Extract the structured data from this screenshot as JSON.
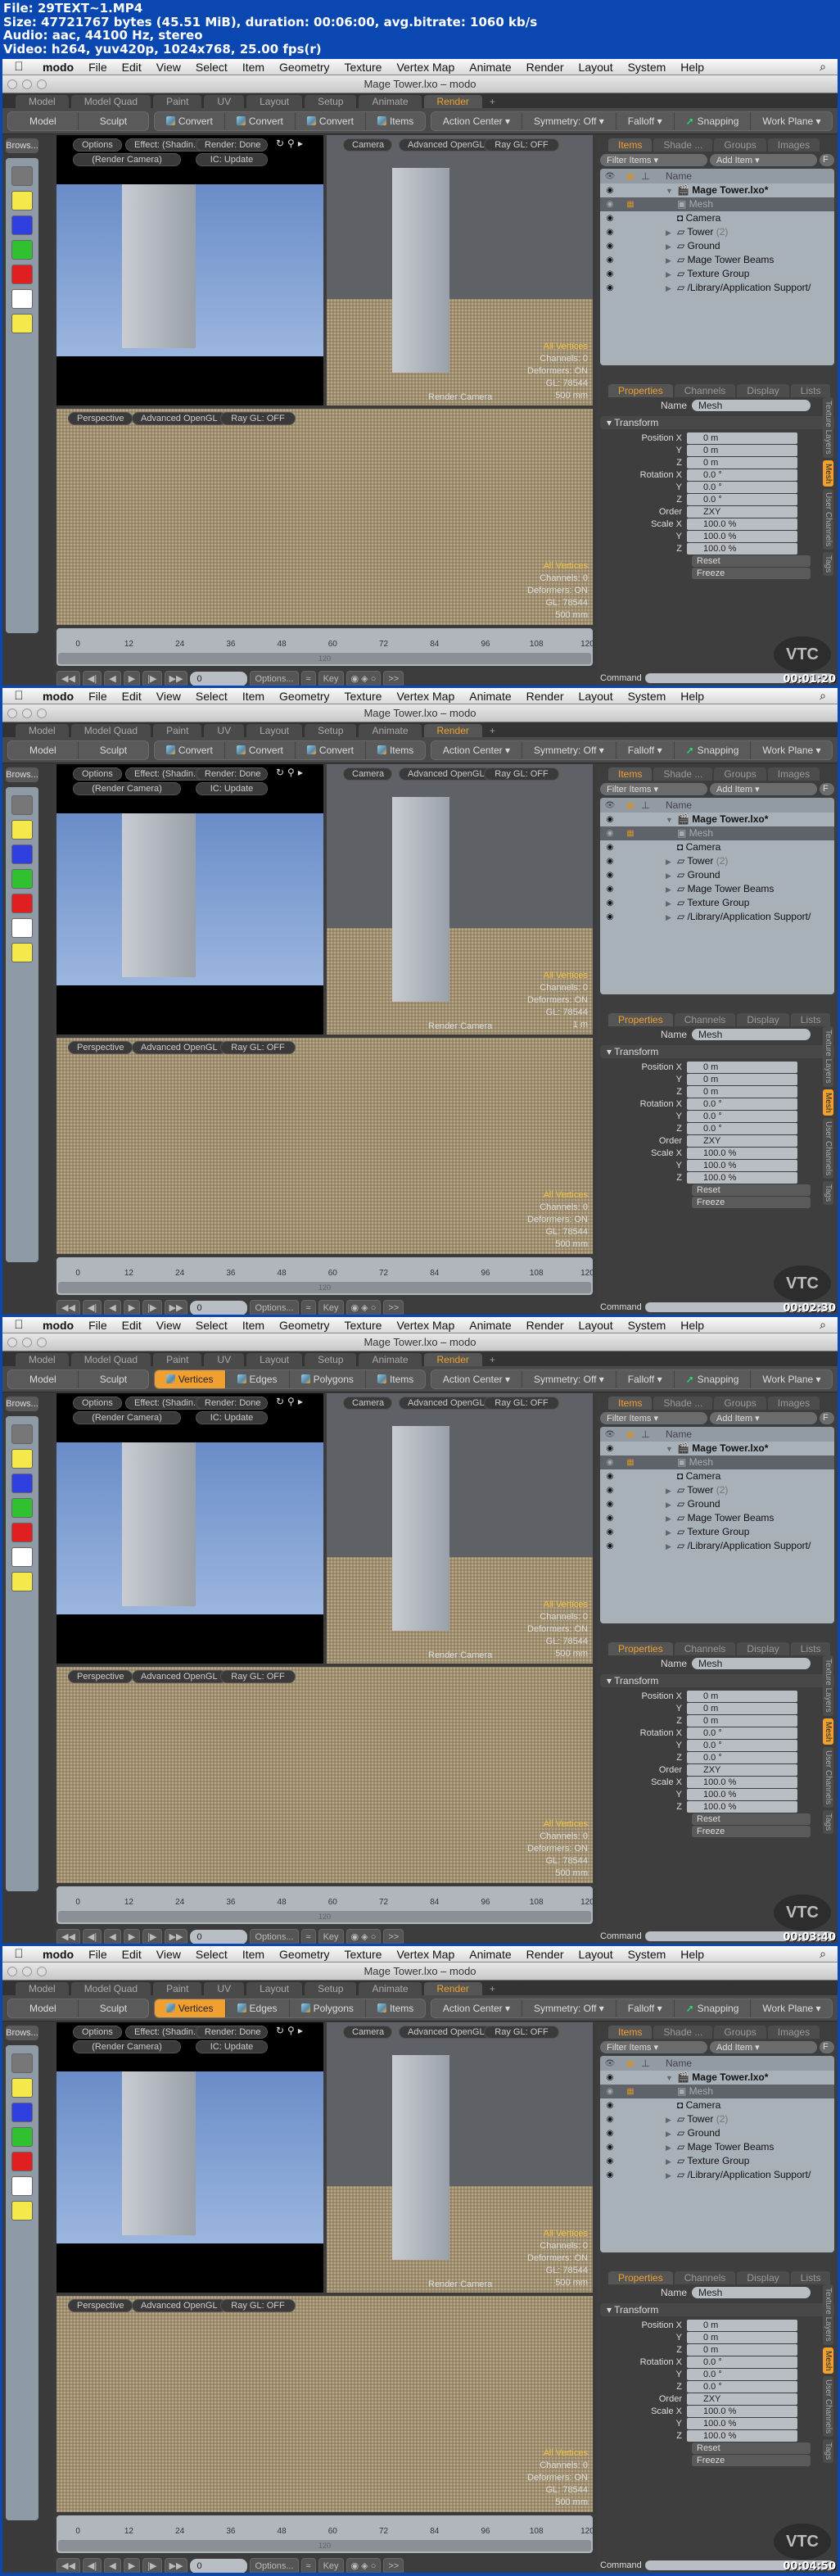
{
  "file_info": {
    "line1": "File: 29TEXT~1.MP4",
    "line2": "Size: 47721767 bytes (45.51 MiB), duration: 00:06:00, avg.bitrate: 1060 kb/s",
    "line3": "Audio: aac, 44100 Hz, stereo",
    "line4": "Video: h264, yuv420p, 1024x768, 25.00 fps(r)"
  },
  "menubar": {
    "apple": "",
    "app": "modo",
    "items": [
      "File",
      "Edit",
      "View",
      "Select",
      "Item",
      "Geometry",
      "Texture",
      "Vertex Map",
      "Animate",
      "Render",
      "Layout",
      "System",
      "Help"
    ],
    "spotlight": "⌕"
  },
  "window_title": "Mage Tower.lxo – modo",
  "layout_tabs": [
    "Model",
    "Model Quad",
    "Paint",
    "UV",
    "Layout",
    "Setup",
    "Animate",
    "Render"
  ],
  "layout_tab_add": "+",
  "toolbar": {
    "mode_buttons": [
      "Model",
      "Sculpt"
    ],
    "convert_buttons": [
      "Convert",
      "Convert",
      "Convert",
      "Items"
    ],
    "select_buttons": [
      "Vertices",
      "Edges",
      "Polygons",
      "Items"
    ],
    "action_center": "Action Center ▾",
    "symmetry": "Symmetry: Off ▾",
    "falloff": "Falloff ▾",
    "snapping": "Snapping",
    "work_plane": "Work Plane ▾"
  },
  "left_tool": {
    "browse": "Brows...",
    "swatches": [
      "#f4e84a",
      "#3040e0",
      "#30c030",
      "#e02020",
      "#ffffff",
      "#f4e84a"
    ]
  },
  "render_view": {
    "options": "Options",
    "effect": "Effect: (Shadin...",
    "status": "Render: Done",
    "camera": "(Render Camera)",
    "ic": "IC: Update"
  },
  "camera_view": {
    "camera": "Camera",
    "shading": "Advanced OpenGL",
    "raygl": "Ray GL: OFF",
    "label": "Render Camera"
  },
  "persp_view": {
    "view": "Perspective",
    "shading": "Advanced OpenGL",
    "raygl": "Ray GL: OFF"
  },
  "hud": {
    "selection": "All Vertices",
    "channels": "Channels: 0",
    "deformers": "Deformers: ON",
    "gl": "GL: 78544"
  },
  "timeline": {
    "ticks": [
      "0",
      "12",
      "24",
      "36",
      "48",
      "60",
      "72",
      "84",
      "96",
      "108",
      "120"
    ],
    "range_end": "120",
    "current_frame": "0",
    "options": "Options...",
    "key": "Key",
    "more": ">>"
  },
  "items_panel": {
    "tabs": [
      "Items",
      "Shade ...",
      "Groups",
      "Images"
    ],
    "filter": "Filter Items ▾",
    "add_item": "Add Item ▾",
    "f_button": "F",
    "column_name": "Name",
    "rows": [
      {
        "name": "Mage Tower.lxo*",
        "arrow": "▼",
        "bold": true,
        "icon": "scene"
      },
      {
        "name": "Mesh",
        "arrow": "",
        "selected": true,
        "icon": "mesh"
      },
      {
        "name": "Camera",
        "arrow": "",
        "icon": "camera"
      },
      {
        "name": "Tower",
        "count": "(2)",
        "arrow": "▶",
        "icon": "folder"
      },
      {
        "name": "Ground",
        "arrow": "▶",
        "icon": "folder"
      },
      {
        "name": "Mage Tower Beams",
        "arrow": "▶",
        "icon": "folder"
      },
      {
        "name": "Texture Group",
        "arrow": "▶",
        "icon": "folder"
      },
      {
        "name": "/Library/Application Support/",
        "arrow": "▶",
        "icon": "folder"
      }
    ]
  },
  "properties_panel": {
    "tabs": [
      "Properties",
      "Channels",
      "Display",
      "Lists"
    ],
    "name_label": "Name",
    "name_value": "Mesh",
    "section": "Transform",
    "rows": [
      {
        "label": "Position X",
        "value": "0 m"
      },
      {
        "label": "Y",
        "value": "0 m"
      },
      {
        "label": "Z",
        "value": "0 m"
      },
      {
        "label": "Rotation X",
        "value": "0.0 °"
      },
      {
        "label": "Y",
        "value": "0.0 °"
      },
      {
        "label": "Z",
        "value": "0.0 °"
      },
      {
        "label": "Order",
        "value": "ZXY"
      },
      {
        "label": "Scale X",
        "value": "100.0 %"
      },
      {
        "label": "Y",
        "value": "100.0 %"
      },
      {
        "label": "Z",
        "value": "100.0 %"
      }
    ],
    "reset": "Reset",
    "freeze": "Freeze",
    "side_tabs": [
      "Texture Layers",
      "Mesh",
      "User Channels",
      "Tags"
    ],
    "command_label": "Command"
  },
  "watermark": "VTC",
  "frames": [
    {
      "timestamp": "00:01:20",
      "toolbar_mode": "convert",
      "cam_distance": "500 mm",
      "persp_distance": "500 mm"
    },
    {
      "timestamp": "00:02:30",
      "toolbar_mode": "convert",
      "cam_distance": "1 m",
      "persp_distance": "500 mm"
    },
    {
      "timestamp": "00:03:40",
      "toolbar_mode": "select",
      "cam_distance": "500 mm",
      "persp_distance": "500 mm"
    },
    {
      "timestamp": "00:04:50",
      "toolbar_mode": "select",
      "cam_distance": "500 mm",
      "persp_distance": "500 mm"
    }
  ]
}
